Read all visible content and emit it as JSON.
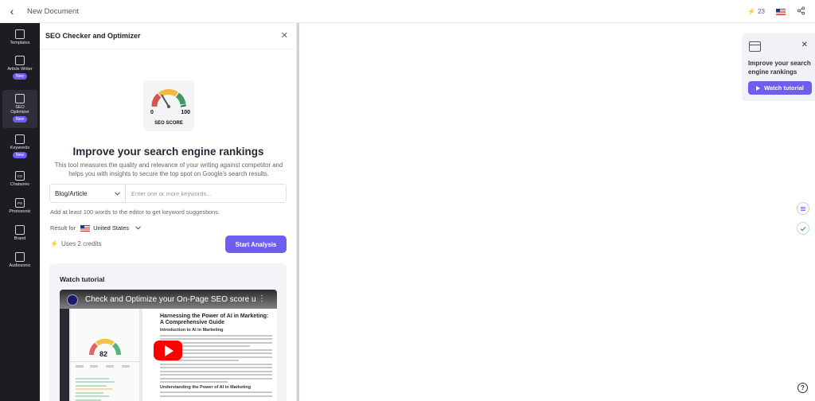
{
  "topbar": {
    "title": "New Document",
    "credits": "23"
  },
  "sidebar": {
    "items": [
      {
        "label": "Templates",
        "icon": "templates-icon"
      },
      {
        "label": "Article Writer",
        "icon": "article-writer-icon",
        "badge": "New"
      },
      {
        "label": "SEO Optimizer",
        "icon": "seo-optimizer-icon",
        "badge": "New"
      },
      {
        "label": "Keywords",
        "icon": "keywords-icon",
        "badge": "New"
      },
      {
        "label": "Chatsonic",
        "icon": "chatsonic-icon",
        "glyph": "CS"
      },
      {
        "label": "Photosonic",
        "icon": "photosonic-icon",
        "glyph": "PS"
      },
      {
        "label": "Brand",
        "icon": "brand-icon"
      },
      {
        "label": "Audiosonic",
        "icon": "audiosonic-icon"
      }
    ]
  },
  "panel": {
    "title": "SEO Checker and Optimizer",
    "gauge": {
      "min_label": "0",
      "max_label": "100",
      "label": "SEO SCORE"
    },
    "headline": "Improve your search engine rankings",
    "description": "This tool measures the quality and relevance of your writing against competitor and helps you with insights to secure the top spot on Google's search results.",
    "content_type": "Blog/Article",
    "keyword_placeholder": "Enter one or more keywords...",
    "hint": "Add at least 100 words to the editor to get keyword suggestions.",
    "result_for_label": "Result for",
    "country": "United States",
    "credits_note": "Uses 2 credits",
    "start_button": "Start Analysis",
    "tutorial": {
      "title": "Watch tutorial",
      "video_title": "Check and Optimize your On-Page SEO score u...",
      "video_doc_heading": "Harnessing the Power of AI in Marketing: A Comprehensive Guide",
      "video_doc_sub1": "Introduction to AI in Marketing",
      "video_doc_sub2": "Understanding the Power of AI in Marketing",
      "video_score": "82"
    }
  },
  "tip": {
    "text": "Improve your search engine rankings",
    "button": "Watch tutorial"
  },
  "colors": {
    "accent": "#6d5ef0",
    "sidebar_bg": "#1c1c22"
  }
}
